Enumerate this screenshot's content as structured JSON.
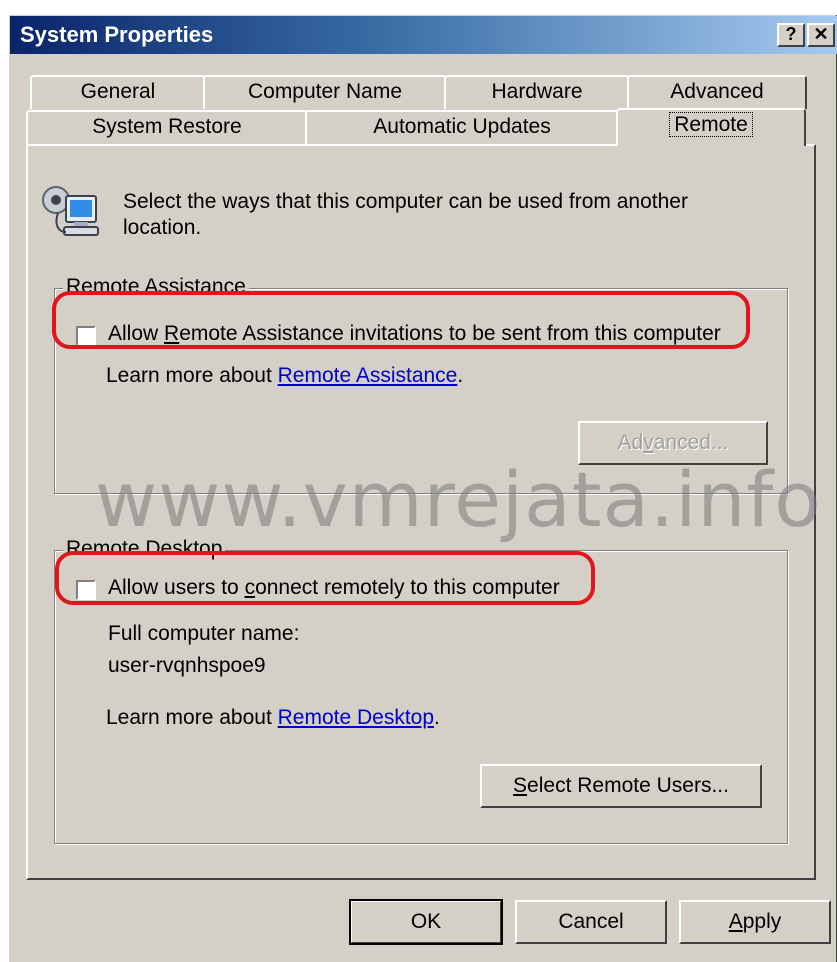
{
  "window": {
    "title": "System Properties",
    "help_button": "?",
    "close_button": "✕"
  },
  "tabs_row1": [
    "General",
    "Computer Name",
    "Hardware",
    "Advanced"
  ],
  "tabs_row2": [
    "System Restore",
    "Automatic Updates",
    "Remote"
  ],
  "active_tab": "Remote",
  "intro_text_line1": "Select the ways that this computer can be used from another",
  "intro_text_line2": "location.",
  "remote_assistance": {
    "group_label": "Remote Assistance",
    "checkbox_label_prefix": "Allow ",
    "checkbox_label_accel": "R",
    "checkbox_label_rest": "emote Assistance invitations to be sent from this computer",
    "checked": false,
    "learn_more_prefix": "Learn more about ",
    "learn_more_link": "Remote Assistance",
    "learn_more_suffix": ".",
    "advanced_button_pre": "Ad",
    "advanced_button_accel": "v",
    "advanced_button_post": "anced...",
    "advanced_enabled": false
  },
  "remote_desktop": {
    "group_label": "Remote Desktop",
    "checkbox_label_prefix": "Allow users to ",
    "checkbox_label_accel": "c",
    "checkbox_label_rest": "onnect remotely to this computer",
    "checked": false,
    "full_name_label": "Full computer name:",
    "computer_name": "user-rvqnhspoe9",
    "learn_more_prefix": "Learn more about ",
    "learn_more_link": "Remote Desktop",
    "learn_more_suffix": ".",
    "select_users_accel": "S",
    "select_users_rest": "elect Remote Users..."
  },
  "footer": {
    "ok": "OK",
    "cancel": "Cancel",
    "apply_accel": "A",
    "apply_rest": "pply"
  },
  "watermark": "www.vmrejata.info",
  "colors": {
    "dialog_bg": "#d4d0c8",
    "title_gradient_start": "#0a246a",
    "title_gradient_end": "#a6caf0",
    "link": "#0000cc",
    "highlight_outline": "#e3141b"
  },
  "icons": {
    "remote_computer": "computer-network-icon",
    "help": "help-icon",
    "close": "close-icon"
  }
}
